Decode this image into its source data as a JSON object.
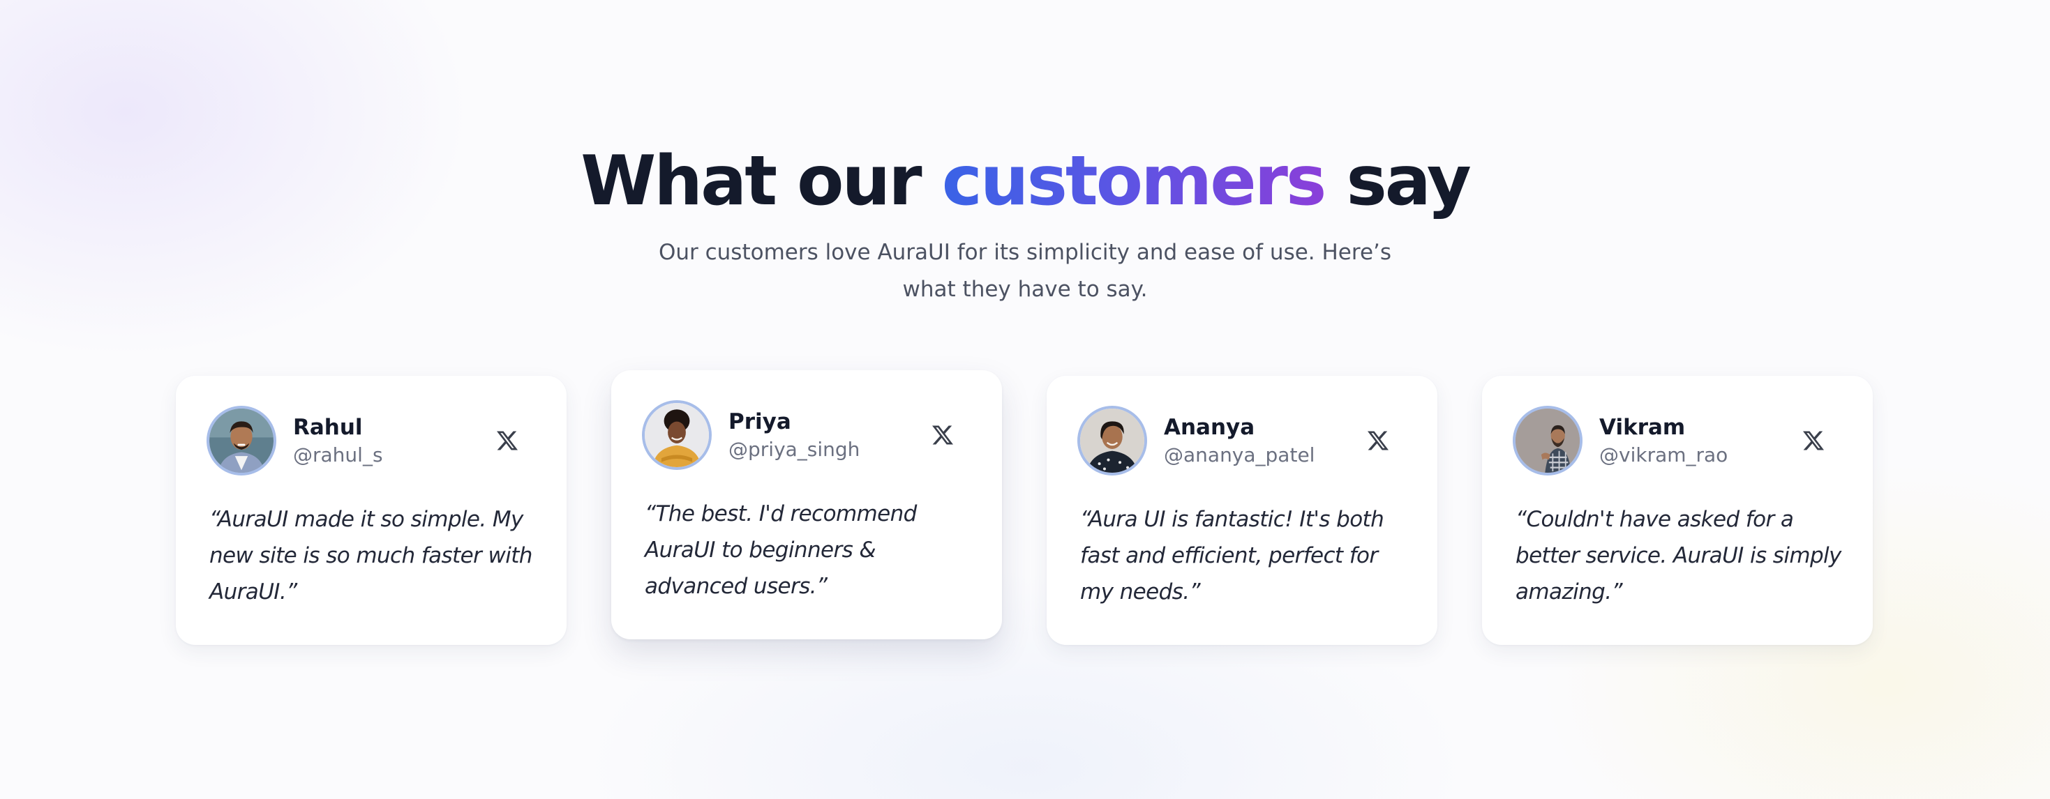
{
  "header": {
    "title_before": "What our",
    "title_accent": "customers",
    "title_after": "say",
    "subtitle": "Our customers love AuraUI for its simplicity and ease of use. Here’s what they have to say."
  },
  "colors": {
    "heading": "#141a2b",
    "accent_gradient_start": "#3a63e6",
    "accent_gradient_end": "#8a3fd9",
    "avatar_ring": "#a7bde9"
  },
  "testimonials": [
    {
      "name": "Rahul",
      "handle": "@rahul_s",
      "quote": "“AuraUI made it so simple. My new site is so much faster with AuraUI.”",
      "platform_icon": "x-icon"
    },
    {
      "name": "Priya",
      "handle": "@priya_singh",
      "quote": "“The best. I'd recommend AuraUI to beginners & advanced users.”",
      "platform_icon": "x-icon"
    },
    {
      "name": "Ananya",
      "handle": "@ananya_patel",
      "quote": "“Aura UI is fantastic! It's both fast and efficient, perfect for my needs.”",
      "platform_icon": "x-icon"
    },
    {
      "name": "Vikram",
      "handle": "@vikram_rao",
      "quote": "“Couldn't have asked for a better service. AuraUI is simply amazing.”",
      "platform_icon": "x-icon"
    }
  ]
}
